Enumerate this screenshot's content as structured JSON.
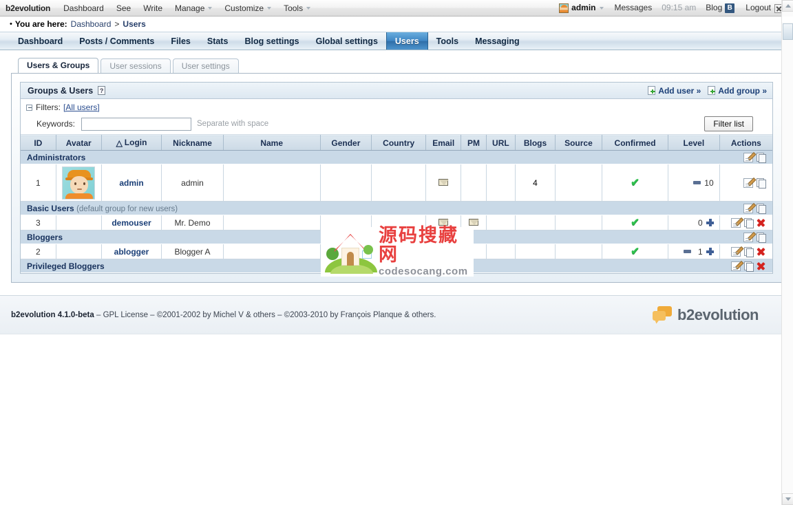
{
  "evobar": {
    "brand": "b2evolution",
    "menu": [
      {
        "label": "Dashboard",
        "caret": false
      },
      {
        "label": "See",
        "caret": false
      },
      {
        "label": "Write",
        "caret": false
      },
      {
        "label": "Manage",
        "caret": true
      },
      {
        "label": "Customize",
        "caret": true
      },
      {
        "label": "Tools",
        "caret": true
      }
    ],
    "user": "admin",
    "messages": "Messages",
    "time": "09:15 am",
    "blog": "Blog",
    "blog_icon_letter": "B",
    "logout": "Logout"
  },
  "breadcrumb": {
    "prefix": "You are here:",
    "root": "Dashboard",
    "separator": ">",
    "current": "Users"
  },
  "mainmenu": {
    "items": [
      {
        "label": "Dashboard",
        "active": false
      },
      {
        "label": "Posts / Comments",
        "active": false
      },
      {
        "label": "Files",
        "active": false
      },
      {
        "label": "Stats",
        "active": false
      },
      {
        "label": "Blog settings",
        "active": false
      },
      {
        "label": "Global settings",
        "active": false
      },
      {
        "label": "Users",
        "active": true
      },
      {
        "label": "Tools",
        "active": false
      },
      {
        "label": "Messaging",
        "active": false
      }
    ]
  },
  "tabs": [
    {
      "label": "Users & Groups",
      "active": true
    },
    {
      "label": "User sessions",
      "active": false
    },
    {
      "label": "User settings",
      "active": false
    }
  ],
  "panel": {
    "title": "Groups & Users",
    "help_icon": "?",
    "add_user": "Add user »",
    "add_group": "Add group »"
  },
  "filters": {
    "label": "Filters:",
    "value": "[All users]",
    "keywords_label": "Keywords:",
    "keywords_value": "",
    "keywords_placeholder": "",
    "hint": "Separate with space",
    "filter_button": "Filter list"
  },
  "table": {
    "columns": [
      "ID",
      "Avatar",
      "Login",
      "Nickname",
      "Name",
      "Gender",
      "Country",
      "Email",
      "PM",
      "URL",
      "Blogs",
      "Source",
      "Confirmed",
      "Level",
      "Actions"
    ],
    "sort_column": "Login",
    "groups": [
      {
        "name": "Administrators",
        "note": "",
        "group_actions": [
          "edit",
          "copy"
        ],
        "rows": [
          {
            "id": "1",
            "avatar": "user-avatar",
            "login": "admin",
            "nickname": "admin",
            "name": "",
            "gender": "",
            "country": "",
            "email": "mail-icon",
            "pm": "",
            "url": "",
            "blogs": "4",
            "source": "",
            "confirmed": "check-icon",
            "level": "10",
            "level_minus": true,
            "level_plus": false,
            "actions": [
              "edit",
              "copy"
            ],
            "tall": true
          }
        ]
      },
      {
        "name": "Basic Users",
        "note": "(default group for new users)",
        "group_actions": [
          "edit",
          "copy"
        ],
        "rows": [
          {
            "id": "3",
            "avatar": "",
            "login": "demouser",
            "nickname": "Mr. Demo",
            "name": "",
            "gender": "",
            "country": "",
            "email": "mail-icon",
            "pm": "pm-icon",
            "url": "",
            "blogs": "",
            "source": "",
            "confirmed": "check-icon",
            "level": "0",
            "level_minus": false,
            "level_plus": true,
            "actions": [
              "edit",
              "copy",
              "delete"
            ],
            "tall": false
          }
        ]
      },
      {
        "name": "Bloggers",
        "note": "",
        "group_actions": [
          "edit",
          "copy"
        ],
        "rows": [
          {
            "id": "2",
            "avatar": "",
            "login": "ablogger",
            "nickname": "Blogger A",
            "name": "",
            "gender": "",
            "country": "",
            "email": "",
            "pm": "",
            "url": "",
            "blogs": "",
            "source": "",
            "confirmed": "check-icon",
            "level": "1",
            "level_minus": true,
            "level_plus": true,
            "actions": [
              "edit",
              "copy",
              "delete"
            ],
            "tall": false
          }
        ]
      },
      {
        "name": "Privileged Bloggers",
        "note": "",
        "group_actions": [
          "edit",
          "copy",
          "delete"
        ],
        "rows": []
      }
    ]
  },
  "footer": {
    "version": "b2evolution 4.1.0-beta",
    "credits": " – GPL License – ©2001-2002 by Michel V & others – ©2003-2010 by François Planque & others.",
    "logo_text": "b2evolution"
  },
  "watermark": {
    "cn": "源码搜藏网",
    "en": "codesocang.com"
  },
  "colors": {
    "accent": "#3f86c4",
    "link": "#1b3f77",
    "group_row": "#c9d9e7",
    "confirmed": "#2fc14f",
    "delete": "#d4231f"
  }
}
